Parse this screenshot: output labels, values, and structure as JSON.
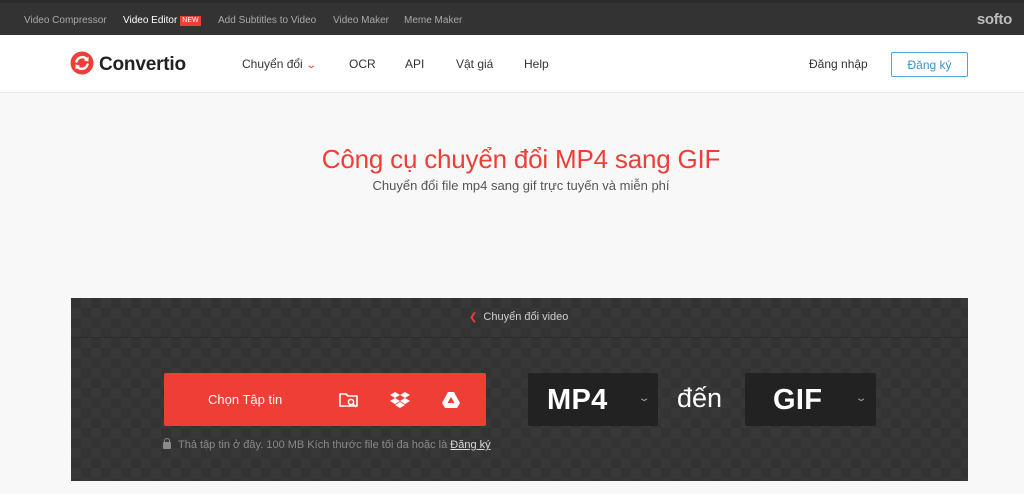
{
  "topbar": {
    "items": [
      "Video Compressor",
      "Video Editor",
      "Add Subtitles to Video",
      "Video Maker",
      "Meme Maker"
    ],
    "new_badge": "NEW",
    "brand": "softo"
  },
  "nav": {
    "logo_text": "Convertio",
    "logo_icon": "convertio-arrows-icon",
    "items": [
      "Chuyển đổi",
      "OCR",
      "API",
      "Vật giá",
      "Help"
    ],
    "login": "Đăng nhập",
    "signup": "Đăng ký"
  },
  "hero": {
    "title": "Công cụ chuyển đổi MP4 sang GIF",
    "subtitle": "Chuyển đổi file mp4 sang gif trực tuyến và miễn phí"
  },
  "converter": {
    "back_link": "Chuyển đổi video",
    "choose_label": "Chọn Tập tin",
    "source_icons": [
      "folder-search-icon",
      "dropbox-icon",
      "google-drive-icon"
    ],
    "from_format": "MP4",
    "to_label": "đến",
    "to_format": "GIF",
    "drop_note": "Thả tập tin ở đây. 100 MB Kích thước file tối đa hoặc là",
    "drop_note_link": "Đăng ký"
  },
  "colors": {
    "accent": "#ef3e36",
    "topbar_bg": "#333333",
    "panel_bg": "#333333",
    "link_blue": "#3d8fc8"
  }
}
